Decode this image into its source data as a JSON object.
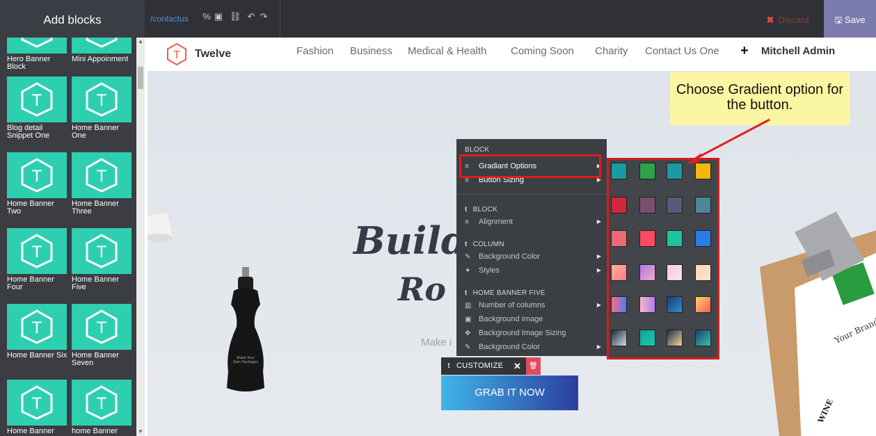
{
  "topbar": {
    "title": "Add blocks",
    "url": "/contactus",
    "discard_label": "Discard",
    "save_label": "Save"
  },
  "sidebar": {
    "blocks": [
      {
        "label": "Hero Banner Block"
      },
      {
        "label": "Mini Appoinment"
      },
      {
        "label": "Blog detail Snippet One"
      },
      {
        "label": "Home Banner One"
      },
      {
        "label": "Home Banner Two"
      },
      {
        "label": "Home Banner Three"
      },
      {
        "label": "Home Banner Four"
      },
      {
        "label": "Home Banner Five"
      },
      {
        "label": "Home Banner Six"
      },
      {
        "label": "Home Banner Seven"
      },
      {
        "label": "Home Banner"
      },
      {
        "label": "home Banner"
      }
    ]
  },
  "site": {
    "brand": "Twelve",
    "nav": [
      "Fashion",
      "Business",
      "Medical & Health",
      "Coming Soon",
      "Charity",
      "Contact Us One"
    ],
    "user": "Mitchell Admin",
    "hero_title_1": "Build",
    "hero_title_2": "Ro",
    "hero_sub": "Make i",
    "cta_label": "GRAB IT NOW",
    "customize_label": "CUSTOMIZE"
  },
  "dropdown": {
    "header_top": "BLOCK",
    "items_top": [
      {
        "label": "Gradiant Options",
        "icon": "list-icon"
      },
      {
        "label": "Button Sizing",
        "icon": "list-icon"
      }
    ],
    "section_block": "BLOCK",
    "block_items": [
      {
        "label": "Alignment",
        "icon": "align-icon"
      }
    ],
    "section_column": "COLUMN",
    "column_items": [
      {
        "label": "Background Color",
        "icon": "brush-icon"
      },
      {
        "label": "Styles",
        "icon": "magic-icon"
      }
    ],
    "section_banner": "HOME BANNER FIVE",
    "banner_items": [
      {
        "label": "Number of columns",
        "icon": "columns-icon"
      },
      {
        "label": "Background Image",
        "icon": "image-icon"
      },
      {
        "label": "Background Image Sizing",
        "icon": "move-icon"
      },
      {
        "label": "Background Color",
        "icon": "brush-icon"
      }
    ]
  },
  "swatches": [
    [
      "#1a9ba0",
      "#2ea24a",
      "#1b9aa3",
      "#f4b70f"
    ],
    [
      "#d0283a",
      "#7a4f6e",
      "#55597a",
      "#4f8499"
    ],
    [
      "#ea6b74",
      "#ff4a5f",
      "#1ec3a0",
      "#2a7de3"
    ],
    [
      "linear-gradient(135deg,#ffb199,#ff7a8a)",
      "linear-gradient(135deg,#a97be8,#f3a8c8)",
      "linear-gradient(135deg,#f9c9e6,#fbe1ef)",
      "linear-gradient(135deg,#fcd2b7,#fbe7cf)"
    ],
    [
      "linear-gradient(90deg,#ff6a88,#4d7bf3)",
      "linear-gradient(90deg,#f6b7c8,#b57cf0)",
      "linear-gradient(135deg,#1e3c72,#2a8fd6)",
      "linear-gradient(135deg,#f6d365,#fd5b5b)"
    ],
    [
      "linear-gradient(135deg,#1d2b3a,#cfd8e3)",
      "linear-gradient(135deg,#0fa39b,#1ec8a8)",
      "linear-gradient(135deg,#1c2f5a,#f5d28a)",
      "linear-gradient(135deg,#1e3c72,#2fc7b1)"
    ]
  ],
  "callout": {
    "text": "Choose Gradient option for the button."
  }
}
